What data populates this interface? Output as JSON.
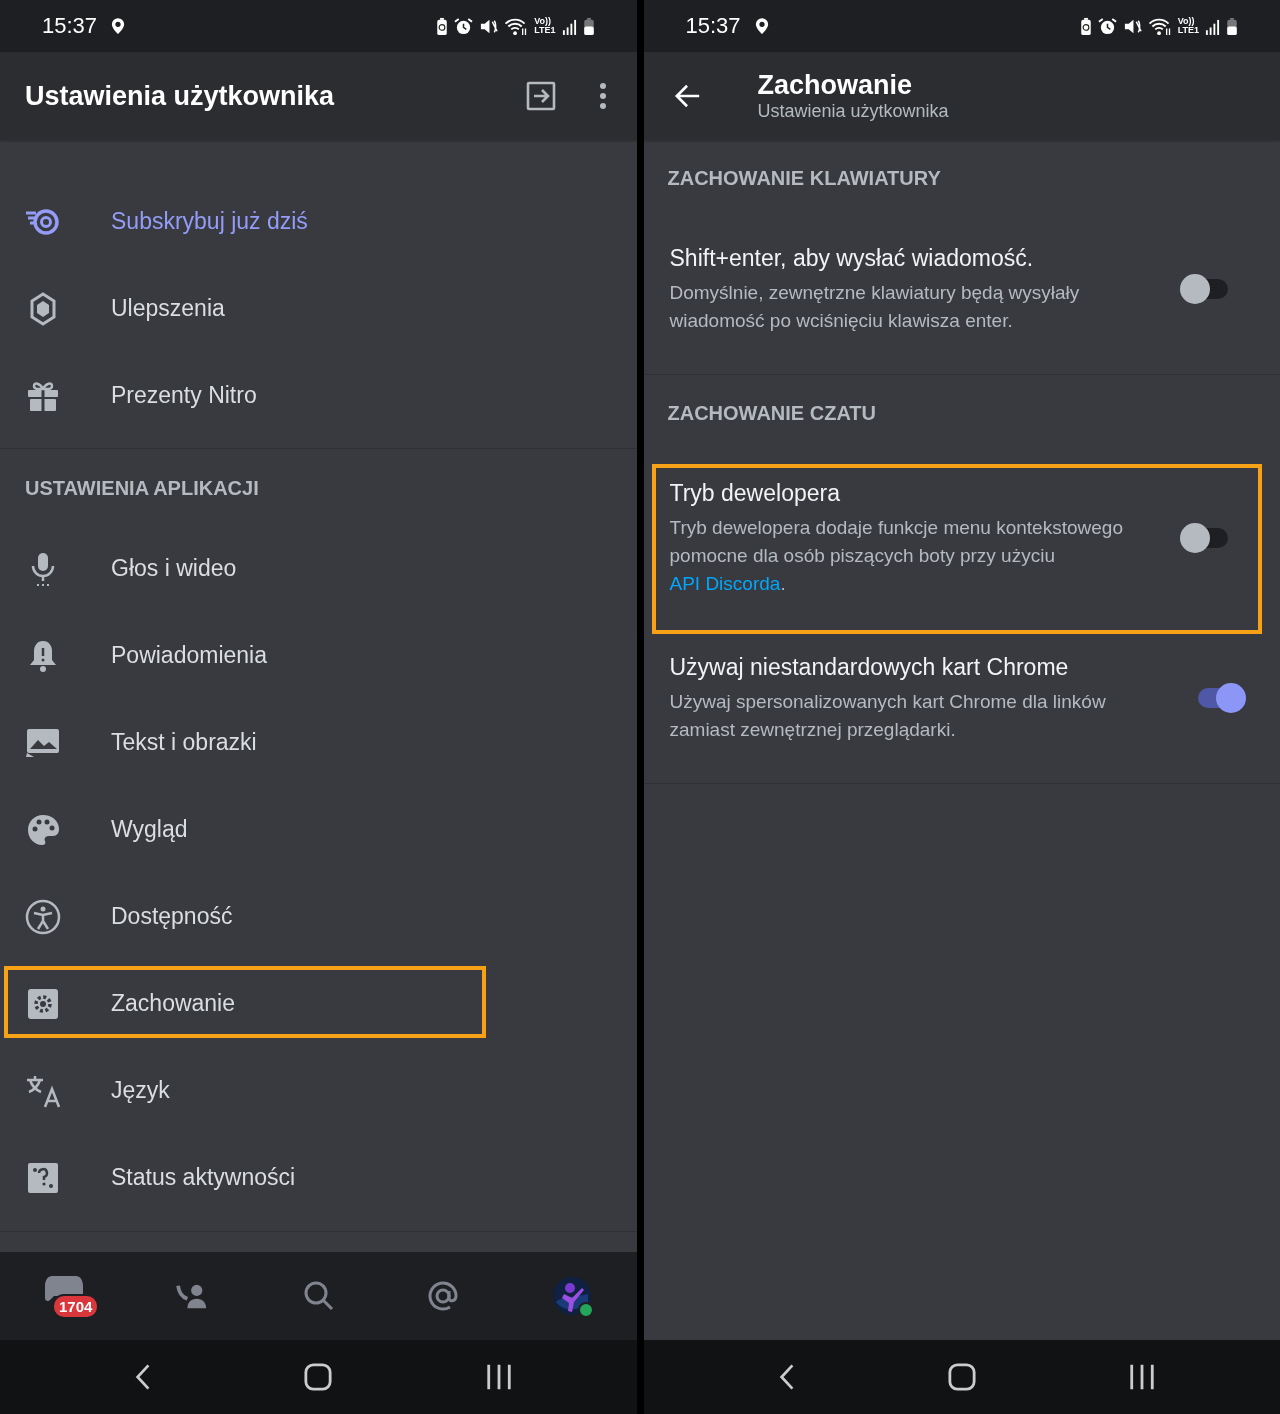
{
  "left": {
    "status_bar": {
      "time": "15:37",
      "network_top": "Vo))",
      "network_bottom": "LTE1"
    },
    "header": {
      "title": "Ustawienia użytkownika"
    },
    "sections": [
      {
        "items": [
          {
            "label": "Subskrybuj już dziś",
            "kind": "accent",
            "highlighted": false
          },
          {
            "label": "Ulepszenia",
            "kind": "normal",
            "highlighted": false
          },
          {
            "label": "Prezenty Nitro",
            "kind": "normal",
            "highlighted": false
          }
        ]
      },
      {
        "title": "USTAWIENIA APLIKACJI",
        "items": [
          {
            "label": "Głos i wideo",
            "kind": "normal",
            "highlighted": false
          },
          {
            "label": "Powiadomienia",
            "kind": "normal",
            "highlighted": false
          },
          {
            "label": "Tekst i obrazki",
            "kind": "normal",
            "highlighted": false
          },
          {
            "label": "Wygląd",
            "kind": "normal",
            "highlighted": false
          },
          {
            "label": "Dostępność",
            "kind": "normal",
            "highlighted": false
          },
          {
            "label": "Zachowanie",
            "kind": "normal",
            "highlighted": true
          },
          {
            "label": "Język",
            "kind": "normal",
            "highlighted": false
          },
          {
            "label": "Status aktywności",
            "kind": "normal",
            "highlighted": false
          }
        ]
      }
    ],
    "bottom_nav": {
      "badge": "1704",
      "online": true
    }
  },
  "right": {
    "status_bar": {
      "time": "15:37",
      "network_top": "Vo))",
      "network_bottom": "LTE1"
    },
    "header": {
      "title": "Zachowanie",
      "subtitle": "Ustawienia użytkownika"
    },
    "sections": [
      {
        "title": "ZACHOWANIE KLAWIATURY",
        "settings": [
          {
            "title": "Shift+enter, aby wysłać wiadomość.",
            "description": "Domyślnie, zewnętrzne klawiatury będą wysyłały wiadomość po wciśnięciu klawisza enter.",
            "on": false,
            "highlighted": false
          }
        ]
      },
      {
        "title": "ZACHOWANIE CZATU",
        "settings": [
          {
            "title": "Tryb dewelopera",
            "description": "Tryb dewelopera dodaje funkcje menu kontekstowego pomocne dla osób piszących boty przy użyciu",
            "link": "API Discorda",
            "after_link": ".",
            "on": false,
            "highlighted": true
          },
          {
            "title": "Używaj niestandardowych kart Chrome",
            "description": "Używaj spersonalizowanych kart Chrome dla linków zamiast zewnętrznej przeglądarki.",
            "on": true,
            "highlighted": false
          }
        ]
      }
    ]
  }
}
